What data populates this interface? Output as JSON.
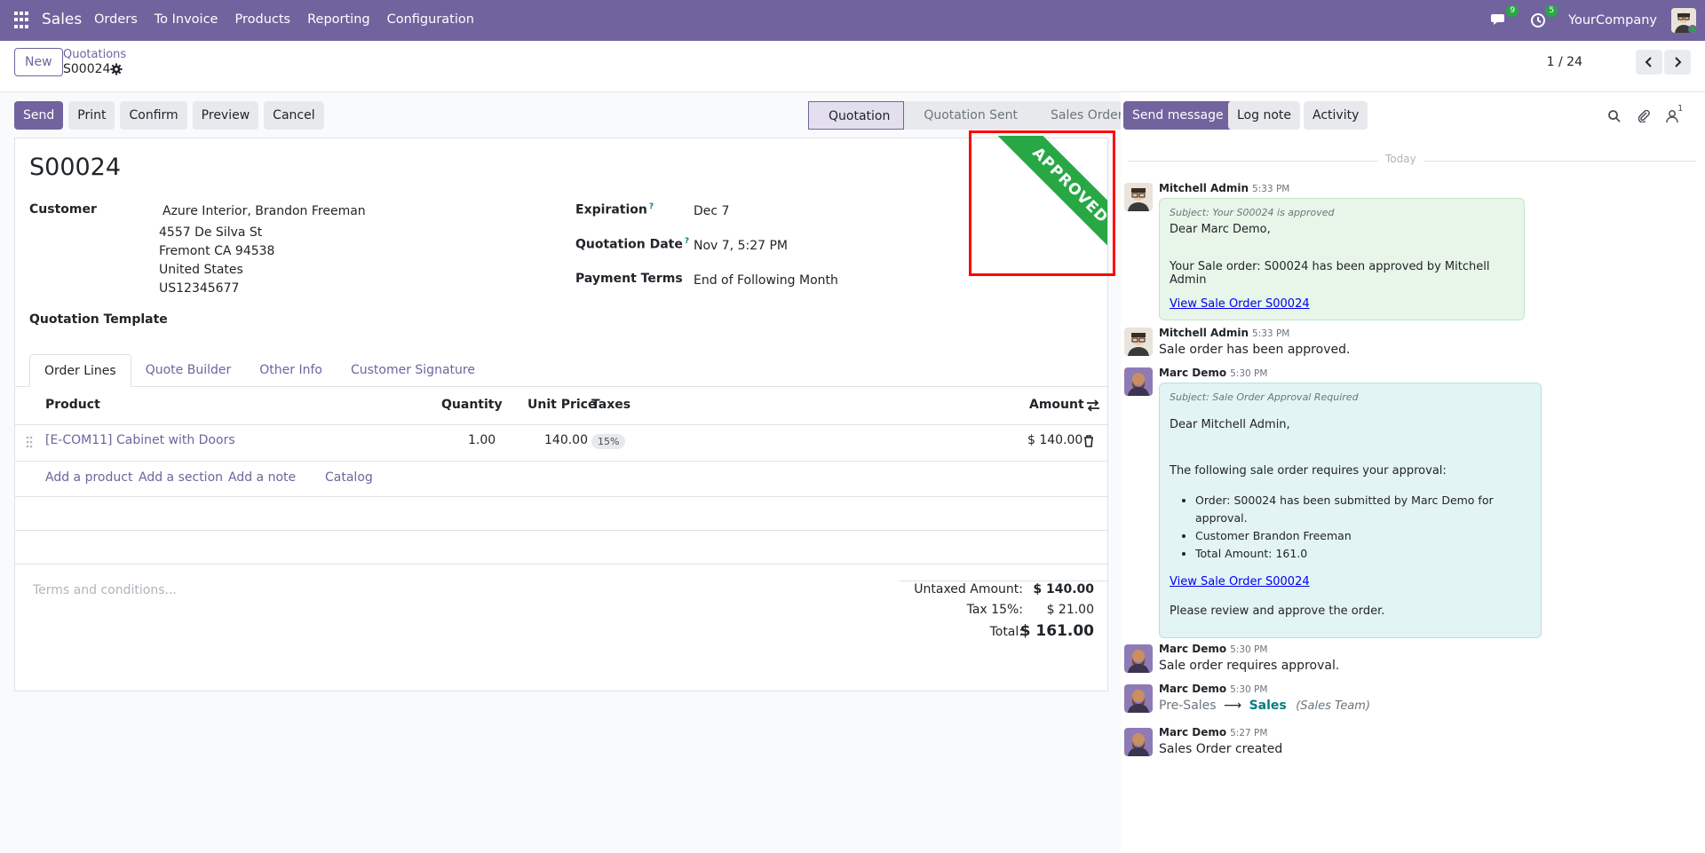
{
  "navbar": {
    "app_name": "Sales",
    "menu": [
      "Orders",
      "To Invoice",
      "Products",
      "Reporting",
      "Configuration"
    ],
    "messages_count": "9",
    "activities_count": "5",
    "company": "YourCompany"
  },
  "control": {
    "new_label": "New",
    "breadcrumb_parent": "Quotations",
    "breadcrumb_current": "S00024",
    "pager": "1 / 24"
  },
  "actions": {
    "send": "Send",
    "print": "Print",
    "confirm": "Confirm",
    "preview": "Preview",
    "cancel": "Cancel"
  },
  "statusbar": [
    "Quotation",
    "Quotation Sent",
    "Sales Order"
  ],
  "ribbon": "APPROVED",
  "form": {
    "title": "S00024",
    "customer_label": "Customer",
    "customer_name": "Azure Interior, Brandon Freeman",
    "address": [
      "4557 De Silva St",
      "Fremont CA 94538",
      "United States",
      "US12345677"
    ],
    "template_label": "Quotation Template",
    "expiration_label": "Expiration",
    "expiration_value": "Dec 7",
    "quotation_date_label": "Quotation Date",
    "quotation_date_value": "Nov 7, 5:27 PM",
    "payment_terms_label": "Payment Terms",
    "payment_terms_value": "End of Following Month",
    "help_mark": "?"
  },
  "tabs": [
    "Order Lines",
    "Quote Builder",
    "Other Info",
    "Customer Signature"
  ],
  "order_lines": {
    "headers": {
      "product": "Product",
      "quantity": "Quantity",
      "unit_price": "Unit Price",
      "taxes": "Taxes",
      "amount": "Amount"
    },
    "rows": [
      {
        "product": "[E-COM11] Cabinet with Doors",
        "quantity": "1.00",
        "unit_price": "140.00",
        "tax": "15%",
        "amount": "$ 140.00"
      }
    ],
    "add_product": "Add a product",
    "add_section": "Add a section",
    "add_note": "Add a note",
    "catalog": "Catalog"
  },
  "terms_placeholder": "Terms and conditions...",
  "totals": {
    "untaxed_label": "Untaxed Amount:",
    "untaxed_value": "$ 140.00",
    "tax_label": "Tax 15%:",
    "tax_value": "$ 21.00",
    "total_label": "Total:",
    "total_value": "$ 161.00"
  },
  "chatter": {
    "send_message": "Send message",
    "log_note": "Log note",
    "activity": "Activity",
    "followers_count": "1",
    "today": "Today",
    "messages": [
      {
        "author": "Mitchell Admin",
        "time": "5:33 PM",
        "subject": "Subject: Your S00024 is approved",
        "lines": [
          "Dear Marc Demo,",
          "Your Sale order: S00024 has been approved by Mitchell Admin"
        ],
        "link": "View Sale Order S00024"
      },
      {
        "author": "Mitchell Admin",
        "time": "5:33 PM",
        "text": "Sale order has been approved."
      },
      {
        "author": "Marc Demo",
        "time": "5:30 PM",
        "subject": "Subject: Sale Order Approval Required",
        "greeting": "Dear Mitchell Admin,",
        "intro": "The following sale order requires your approval:",
        "bullets": [
          "Order: S00024 has been submitted by Marc Demo for approval.",
          "Customer Brandon Freeman",
          "Total Amount: 161.0"
        ],
        "link": "View Sale Order S00024",
        "closing": "Please review and approve the order."
      },
      {
        "author": "Marc Demo",
        "time": "5:30 PM",
        "text": "Sale order requires approval."
      },
      {
        "author": "Marc Demo",
        "time": "5:30 PM",
        "from": "Pre-Sales",
        "arrow": "⟶",
        "to": "Sales",
        "field": "(Sales Team)"
      },
      {
        "author": "Marc Demo",
        "time": "5:27 PM",
        "text": "Sales Order created"
      }
    ]
  },
  "colors": {
    "brand": "#71639e",
    "ribbon": "#28a745",
    "highlight": "#ff0000"
  }
}
